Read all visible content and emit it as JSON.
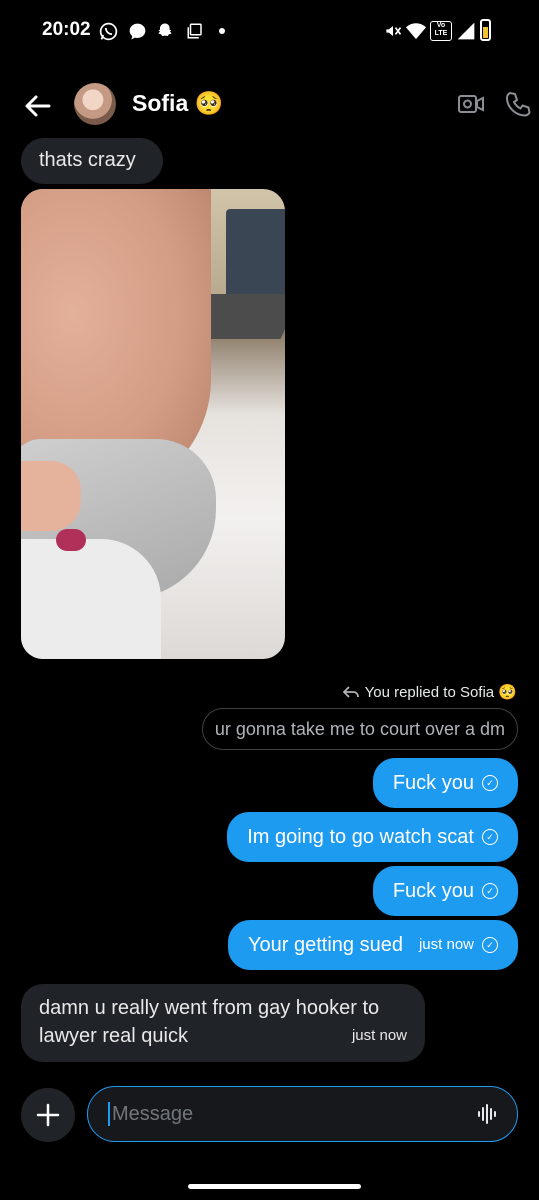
{
  "status_bar": {
    "time": "20:02",
    "lte": "Vo LTE"
  },
  "header": {
    "name": "Sofia 🥺"
  },
  "messages": {
    "top_incoming": "thats crazy",
    "reply_note": "You replied to Sofia 🥺",
    "quoted": "ur gonna take me to court over a dm",
    "out1": "Fuck you",
    "out2": "Im going to go watch scat",
    "out3": "Fuck you",
    "out4": "Your getting sued",
    "out4_time": "just now",
    "incoming_last": "damn u really went from gay hooker to lawyer real quick",
    "incoming_last_time": "just now"
  },
  "composer": {
    "placeholder": "Message"
  },
  "colors": {
    "accent": "#1d9bf0",
    "incoming_bg": "#202327",
    "background": "#000000"
  }
}
